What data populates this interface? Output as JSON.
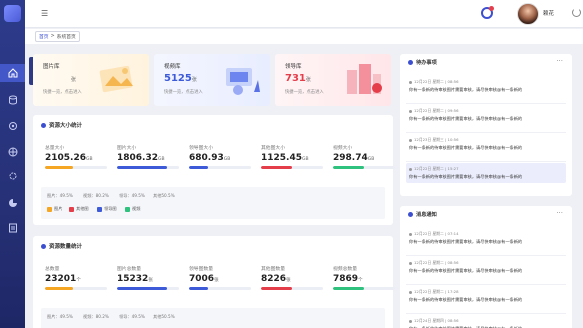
{
  "sidebar": {
    "tooltip_title": "首页",
    "tooltip_sub": "系统首页"
  },
  "topbar": {
    "username": "赖花"
  },
  "breadcrumb": {
    "home": "首页",
    "current": "系统首页"
  },
  "cards": [
    {
      "title": "图片库",
      "count": "",
      "unit": "张",
      "desc": "快捷一览，点击进入",
      "color": "#333"
    },
    {
      "title": "视频库",
      "count": "5125",
      "unit": "张",
      "desc": "快捷一览，点击进入",
      "color": "#3d5bd9"
    },
    {
      "title": "领导库",
      "count": "731",
      "unit": "张",
      "desc": "快捷一览，点击进入",
      "color": "#e53e4b"
    }
  ],
  "size_stats": {
    "title": "资源大小统计",
    "items": [
      {
        "label": "总量大小",
        "value": "2105.26",
        "unit": "GB",
        "fill": 0.45,
        "color": "#f5a623"
      },
      {
        "label": "图片大小",
        "value": "1806.32",
        "unit": "GB",
        "fill": 0.8,
        "color": "#3d5bd9"
      },
      {
        "label": "领导图大小",
        "value": "680.93",
        "unit": "GB",
        "fill": 0.3,
        "color": "#3d5bd9"
      },
      {
        "label": "其他图大小",
        "value": "1125.45",
        "unit": "GB",
        "fill": 0.5,
        "color": "#e53e4b"
      },
      {
        "label": "视频大小",
        "value": "298.74",
        "unit": "GB",
        "fill": 0.5,
        "color": "#2ec27e"
      }
    ],
    "percents": [
      "图片：49.5%",
      "视频：80.2%",
      "领导：49.5%",
      "其他50.5%"
    ],
    "legend": [
      {
        "label": "图片",
        "color": "#f5a623"
      },
      {
        "label": "其他图",
        "color": "#e53e4b"
      },
      {
        "label": "领导图",
        "color": "#3d5bd9"
      },
      {
        "label": "视频",
        "color": "#2ec27e"
      }
    ]
  },
  "count_stats": {
    "title": "资源数量统计",
    "items": [
      {
        "label": "总数量",
        "value": "23201",
        "unit": "个",
        "fill": 0.45,
        "color": "#f5a623"
      },
      {
        "label": "图片总数量",
        "value": "15232",
        "unit": "张",
        "fill": 0.8,
        "color": "#3d5bd9"
      },
      {
        "label": "领导图数量",
        "value": "7006",
        "unit": "张",
        "fill": 0.3,
        "color": "#3d5bd9"
      },
      {
        "label": "其他图数量",
        "value": "8226",
        "unit": "张",
        "fill": 0.5,
        "color": "#e53e4b"
      },
      {
        "label": "视频总数量",
        "value": "7869",
        "unit": "个",
        "fill": 0.5,
        "color": "#2ec27e"
      }
    ],
    "percents": [
      "图片：49.5%",
      "视频：80.2%",
      "领导：49.5%",
      "其他50.5%"
    ]
  },
  "todo": {
    "title": "待办事项",
    "items": [
      {
        "time": "12月22日 星期二 | 08:56",
        "text": "你有一条新的待审核图片需要审核，请尽快审核@有一条新的"
      },
      {
        "time": "12月22日 星期二 | 09:56",
        "text": "你有一条新的待审核图片需要审核，请尽快审核@有一条新的"
      },
      {
        "time": "12月23日 星期三 | 10:56",
        "text": "你有一条新的待审核图片需要审核，请尽快审核@有一条新的"
      },
      {
        "time": "12月22日 星期二 | 15:27",
        "text": "你有一条新的待审核图片需要审核，请尽快审核@有一条新的"
      }
    ]
  },
  "notices": {
    "title": "消息通知",
    "items": [
      {
        "time": "12月22日 星期二 | 07:14",
        "text": "你有一条新的待审核图片需要审核，请尽快审核@有一条新的"
      },
      {
        "time": "12月22日 星期二 | 08:56",
        "text": "你有一条新的待审核图片需要审核，请尽快审核@有一条新的"
      },
      {
        "time": "12月22日 星期二 | 17:28",
        "text": "你有一条新的待审核图片需要审核，请尽快审核@有一条新的"
      },
      {
        "time": "12月24日 星期四 | 08:56",
        "text": "你有一条新的待审核图片需要审核，请尽快审核@有一条新的"
      }
    ]
  }
}
